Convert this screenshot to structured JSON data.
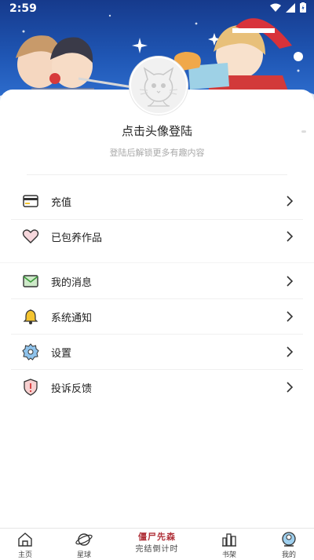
{
  "status_bar": {
    "time": "2:59"
  },
  "banner": {
    "alt": "Christmas illustration"
  },
  "login": {
    "title": "点击头像登陆",
    "subtitle": "登陆后解锁更多有趣内容"
  },
  "menu": {
    "items": [
      {
        "label": "充值",
        "icon": "wallet-icon"
      },
      {
        "label": "已包养作品",
        "icon": "heart-icon"
      },
      {
        "label": "我的消息",
        "icon": "message-icon"
      },
      {
        "label": "系统通知",
        "icon": "bell-icon"
      },
      {
        "label": "设置",
        "icon": "settings-icon"
      },
      {
        "label": "投诉反馈",
        "icon": "feedback-shield-icon"
      }
    ]
  },
  "tabbar": {
    "tabs": [
      {
        "label": "主页",
        "icon": "home-icon"
      },
      {
        "label": "星球",
        "icon": "planet-icon"
      },
      {
        "label": "书架",
        "icon": "bookshelf-icon"
      },
      {
        "label": "我的",
        "icon": "profile-icon"
      }
    ],
    "center": {
      "top": "僵尸先森",
      "bottom": "完结倒计时"
    }
  },
  "colors": {
    "banner_blue": "#1f56b4",
    "message_green": "#3a9a3a",
    "bell_yellow": "#f4c430",
    "gear_blue": "#8fc3ec",
    "alert_red": "#d84444"
  }
}
